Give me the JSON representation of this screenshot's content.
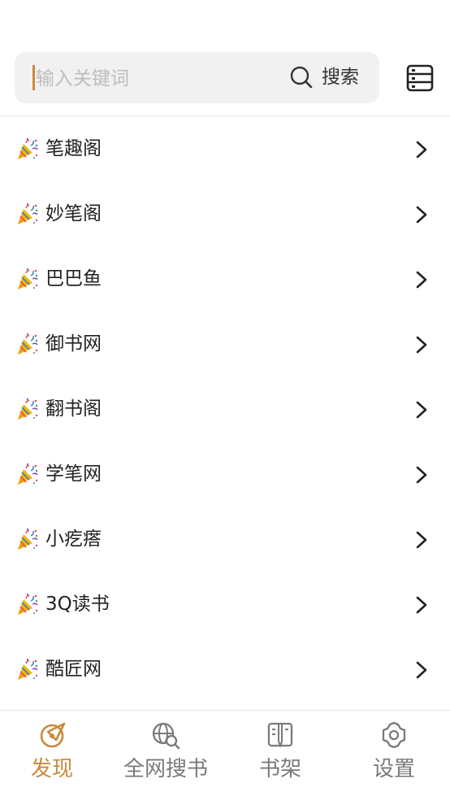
{
  "search": {
    "placeholder": "输入关键词",
    "button_label": "搜索"
  },
  "sources": [
    {
      "label": "笔趣阁"
    },
    {
      "label": "妙笔阁"
    },
    {
      "label": "巴巴鱼"
    },
    {
      "label": "御书网"
    },
    {
      "label": "翻书阁"
    },
    {
      "label": "学笔网"
    },
    {
      "label": "小疙瘩"
    },
    {
      "label": "3Q读书"
    },
    {
      "label": "酷匠网"
    }
  ],
  "tabs": [
    {
      "label": "发现",
      "icon": "compass-icon",
      "active": true
    },
    {
      "label": "全网搜书",
      "icon": "globe-search-icon",
      "active": false
    },
    {
      "label": "书架",
      "icon": "book-icon",
      "active": false
    },
    {
      "label": "设置",
      "icon": "gear-icon",
      "active": false
    }
  ],
  "colors": {
    "accent": "#c98b3e",
    "inactive": "#7a7a7a",
    "search_bg": "#f1f1f1"
  }
}
